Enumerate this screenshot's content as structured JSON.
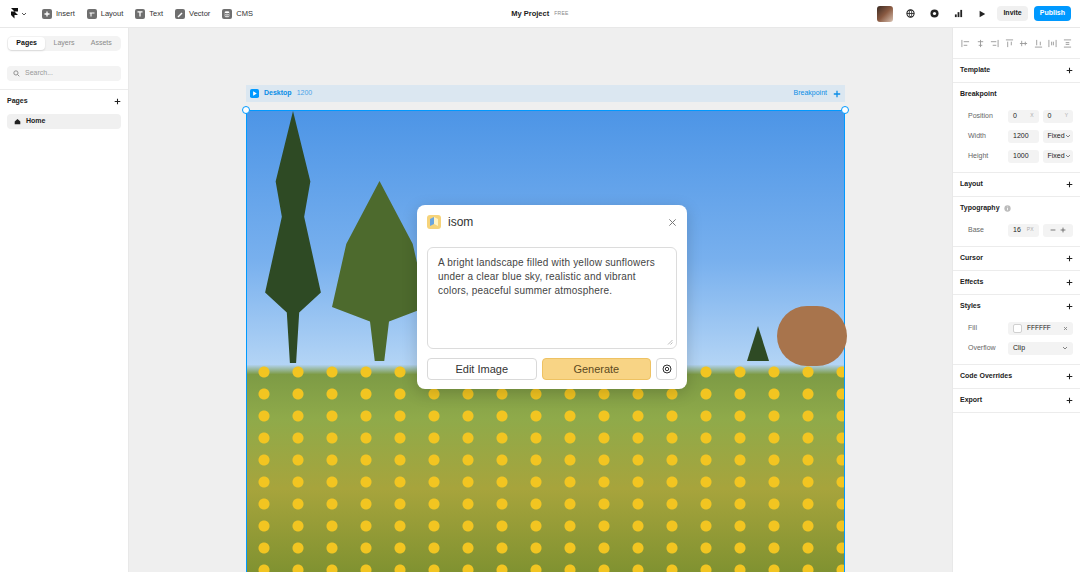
{
  "toolbar": {
    "menu": [
      {
        "label": "Insert"
      },
      {
        "label": "Layout"
      },
      {
        "label": "Text"
      },
      {
        "label": "Vector"
      },
      {
        "label": "CMS"
      }
    ],
    "project": "My Project",
    "plan": "FREE",
    "invite": "Invite",
    "publish": "Publish"
  },
  "sidebar": {
    "tabs": [
      {
        "label": "Pages",
        "selected": true
      },
      {
        "label": "Layers",
        "selected": false
      },
      {
        "label": "Assets",
        "selected": false
      }
    ],
    "search": {
      "placeholder": "Search..."
    },
    "section": "Pages",
    "pages": [
      {
        "label": "Home",
        "selected": true
      }
    ]
  },
  "canvas": {
    "frame": {
      "name": "Desktop",
      "width": "1200",
      "breakpoint": "Breakpoint",
      "selected": true
    }
  },
  "dialog": {
    "title": "isom",
    "prompt": "A bright landscape filled with yellow sunflowers under a clear blue sky, realistic and vibrant colors, peaceful summer atmosphere.",
    "buttons": [
      {
        "label": "Edit Image",
        "kind": "secondary"
      },
      {
        "label": "Generate",
        "kind": "primary"
      }
    ]
  },
  "properties": {
    "sections": [
      {
        "title": "Template",
        "kind": "add",
        "rows": []
      },
      {
        "title": "Breakpoint",
        "kind": "plain",
        "rows": [
          {
            "label": "Position",
            "kind": "pair",
            "fields": [
              {
                "value": "0",
                "suffix": "X"
              },
              {
                "value": "0",
                "suffix": "Y"
              }
            ]
          },
          {
            "label": "Width",
            "kind": "size",
            "value": "1200",
            "mode": "Fixed"
          },
          {
            "label": "Height",
            "kind": "size",
            "value": "1000",
            "mode": "Fixed"
          }
        ]
      },
      {
        "title": "Layout",
        "kind": "add",
        "rows": []
      },
      {
        "title": "Typography",
        "kind": "info",
        "rows": [
          {
            "label": "Base",
            "kind": "stepper",
            "value": "16",
            "suffix": "PX"
          }
        ]
      },
      {
        "title": "Cursor",
        "kind": "add",
        "rows": []
      },
      {
        "title": "Effects",
        "kind": "add",
        "rows": []
      },
      {
        "title": "Styles",
        "kind": "add",
        "rows": [
          {
            "label": "Fill",
            "kind": "color",
            "value": "FFFFFF",
            "color": "#ffffff"
          },
          {
            "label": "Overflow",
            "kind": "select",
            "value": "Clip"
          }
        ]
      },
      {
        "title": "Code Overrides",
        "kind": "add",
        "rows": []
      },
      {
        "title": "Export",
        "kind": "add",
        "rows": []
      }
    ]
  }
}
